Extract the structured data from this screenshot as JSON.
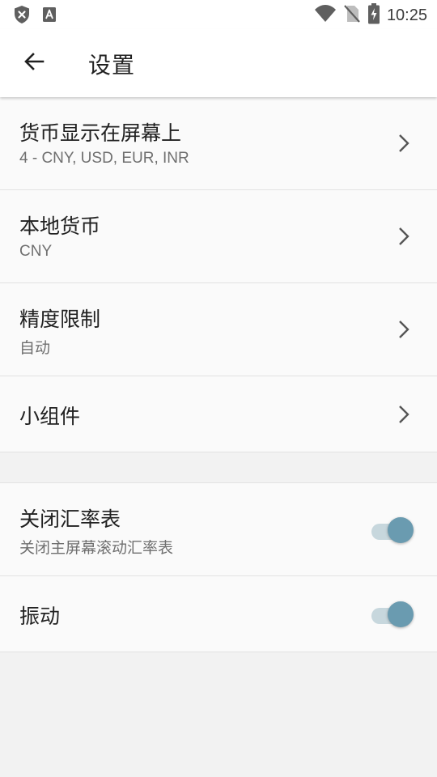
{
  "status_bar": {
    "time": "10:25",
    "left_icons": [
      "shield-x-icon",
      "font-a-icon"
    ],
    "right_icons": [
      "wifi-icon",
      "no-sim-icon",
      "battery-charging-icon"
    ]
  },
  "app_bar": {
    "back_icon": "arrow-back-icon",
    "title": "设置"
  },
  "settings": [
    {
      "title": "货币显示在屏幕上",
      "subtitle": "4 - CNY, USD, EUR, INR",
      "control": "chevron"
    },
    {
      "title": "本地货币",
      "subtitle": "CNY",
      "control": "chevron"
    },
    {
      "title": "精度限制",
      "subtitle": "自动",
      "control": "chevron"
    },
    {
      "title": "小组件",
      "subtitle": "",
      "control": "chevron"
    }
  ],
  "toggles": [
    {
      "title": "关闭汇率表",
      "subtitle": "关闭主屏幕滚动汇率表",
      "checked": true
    },
    {
      "title": "振动",
      "subtitle": "",
      "checked": true
    }
  ],
  "colors": {
    "accent": "#6a9bb0",
    "switch_track": "#c7d7dd",
    "background": "#f2f2f2",
    "row_background": "#fafafa"
  }
}
